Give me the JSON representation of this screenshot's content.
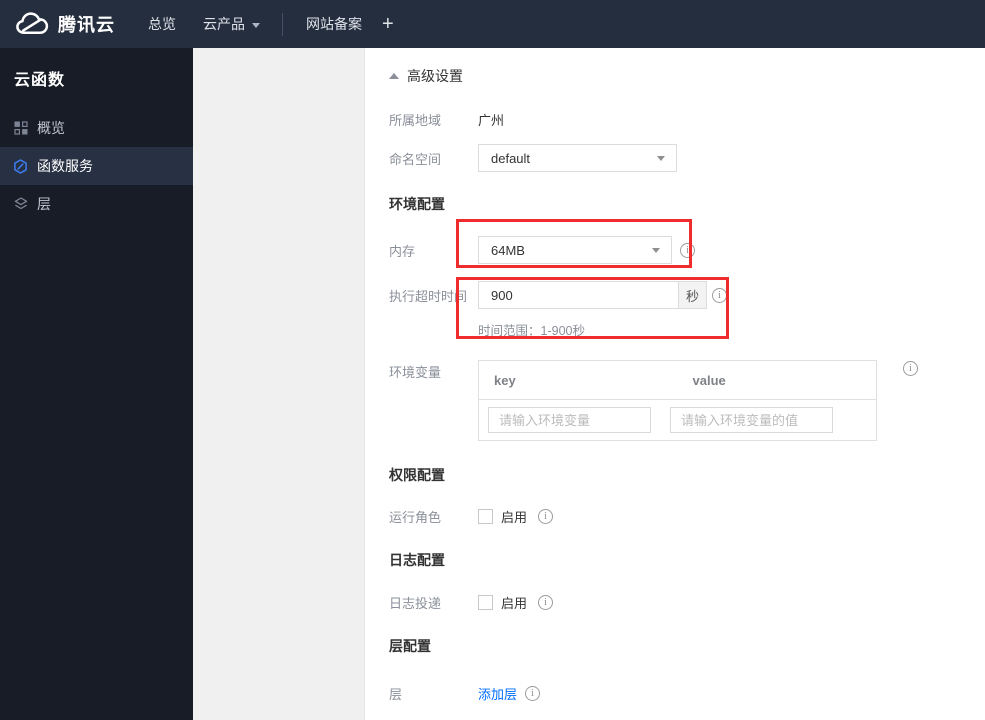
{
  "topbar": {
    "brand": "腾讯云",
    "nav": [
      {
        "label": "总览"
      },
      {
        "label": "云产品"
      },
      {
        "label": "网站备案"
      }
    ],
    "plus": "+"
  },
  "sidebar": {
    "title": "云函数",
    "items": [
      {
        "label": "概览",
        "icon": "grid-icon",
        "selected": false
      },
      {
        "label": "函数服务",
        "icon": "function-hexagon-icon",
        "selected": true
      },
      {
        "label": "层",
        "icon": "layers-icon",
        "selected": false
      }
    ]
  },
  "form": {
    "advanced_toggle": "高级设置",
    "region": {
      "label": "所属地域",
      "value": "广州"
    },
    "namespace": {
      "label": "命名空间",
      "value": "default"
    },
    "section_env": "环境配置",
    "memory": {
      "label": "内存",
      "value": "64MB"
    },
    "timeout": {
      "label": "执行超时时间",
      "value": "900",
      "unit": "秒",
      "hint": "时间范围：1-900秒"
    },
    "env_vars": {
      "label": "环境变量",
      "key_header": "key",
      "value_header": "value",
      "key_placeholder": "请输入环境变量",
      "value_placeholder": "请输入环境变量的值"
    },
    "section_perm": "权限配置",
    "role": {
      "label": "运行角色",
      "enable": "启用"
    },
    "section_log": "日志配置",
    "log": {
      "label": "日志投递",
      "enable": "启用"
    },
    "section_layer": "层配置",
    "layer": {
      "label": "层",
      "add_link": "添加层"
    }
  },
  "icons": {
    "info_glyph": "i"
  },
  "colors": {
    "topbar_bg": "#252e3e",
    "sidebar_bg": "#171c27",
    "sidebar_selected_bg": "#273143",
    "accent_blue": "#006eff",
    "annotation_red": "#ee2c2c"
  }
}
